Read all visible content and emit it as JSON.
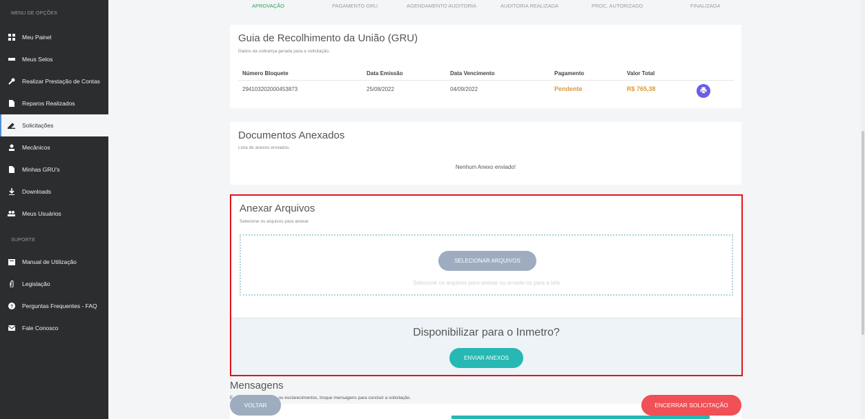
{
  "sidebar": {
    "section_options": "MENU DE OPÇÕES",
    "section_support": "SUPORTE",
    "items": [
      {
        "label": "Meu Painel",
        "icon": "dashboard-icon"
      },
      {
        "label": "Meus Selos",
        "icon": "stamp-icon"
      },
      {
        "label": "Realizar Prestação de Contas",
        "icon": "wrench-icon"
      },
      {
        "label": "Reparos Realizados",
        "icon": "document-icon"
      },
      {
        "label": "Solicitações",
        "icon": "pen-icon"
      },
      {
        "label": "Mecânicos",
        "icon": "person-icon"
      },
      {
        "label": "Minhas GRU's",
        "icon": "file-icon"
      },
      {
        "label": "Downloads",
        "icon": "download-icon"
      },
      {
        "label": "Meus Usuários",
        "icon": "users-icon"
      }
    ],
    "support_items": [
      {
        "label": "Manual de Utilização",
        "icon": "book-icon"
      },
      {
        "label": "Legislação",
        "icon": "paperclip-icon"
      },
      {
        "label": "Perguntas Frequentes - FAQ",
        "icon": "question-icon"
      },
      {
        "label": "Fale Conosco",
        "icon": "envelope-icon"
      }
    ]
  },
  "steps": [
    "APROVAÇÃO",
    "PAGAMENTO GRU",
    "AGENDAMENTO AUDITORIA",
    "AUDITORIA REALIZADA",
    "PROC. AUTORIZADO",
    "FINALIZADA"
  ],
  "gru": {
    "title": "Guia de Recolhimento da União (GRU)",
    "subtitle": "Dados da cobrança gerada para a solicitação.",
    "headers": [
      "Número Bloquete",
      "Data Emissão",
      "Data Vencimento",
      "Pagamento",
      "Valor Total"
    ],
    "row": {
      "number": "294103202000453873",
      "issue_date": "25/08/2022",
      "due_date": "04/09/2022",
      "payment": "Pendente",
      "total": "R$ 765,38"
    }
  },
  "documents": {
    "title": "Documentos Anexados",
    "subtitle": "Lista de anexos enviados.",
    "empty": "Nenhum Anexo enviado!"
  },
  "attach": {
    "title": "Anexar Arquivos",
    "subtitle": "Selecione os arquivos para anexar",
    "select_button": "SELECIONAR ARQUIVOS",
    "drop_hint": "Selecione os arquivos para anexar ou arraste-os para a tela",
    "question": "Disponibilizar para o Inmetro?",
    "send_button": "ENVIAR ANEXOS"
  },
  "messages": {
    "title": "Mensagens",
    "subtitle_tail": "ou esclarecimentos, troque mensagens para concluir a solicitação.",
    "subtitle_head": "E"
  },
  "actions": {
    "back": "VOLTAR",
    "close": "ENCERRAR SOLICITAÇÃO"
  },
  "colors": {
    "sidebar": "#2b2d2f",
    "accent_teal": "#26b8b2",
    "danger": "#f05056",
    "pending": "#d69a3a",
    "step_done": "#2fa05a",
    "highlight_border": "#e0131b"
  }
}
